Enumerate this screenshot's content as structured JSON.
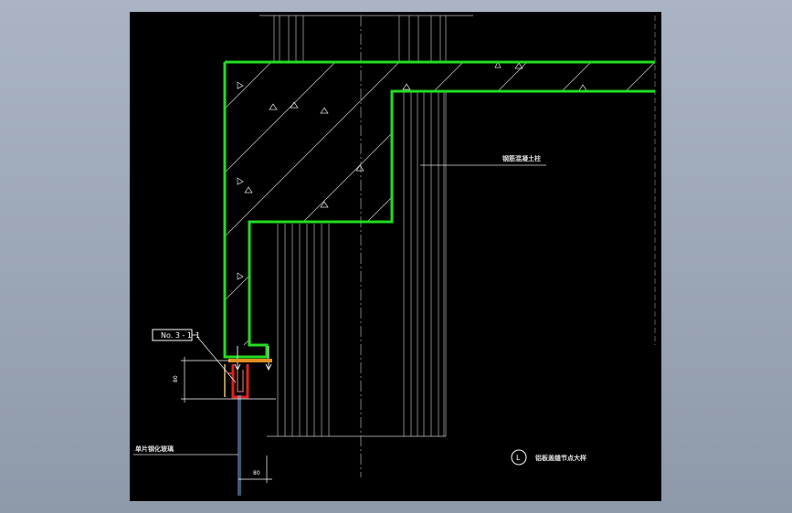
{
  "drawing": {
    "labels": {
      "column": "钢筋混凝土柱",
      "glass": "单片钢化玻璃",
      "title": "铝板盖缝节点大样",
      "detail_ref": "No. 3 - 1",
      "detail_num": "1",
      "detail_circle": "L"
    },
    "dimensions": {
      "vertical": "80",
      "horizontal": "80"
    },
    "colors": {
      "background": "#000000",
      "concrete_outline": "#22dd22",
      "frame": "#dd2222",
      "lines": "#c8c8c8"
    }
  }
}
